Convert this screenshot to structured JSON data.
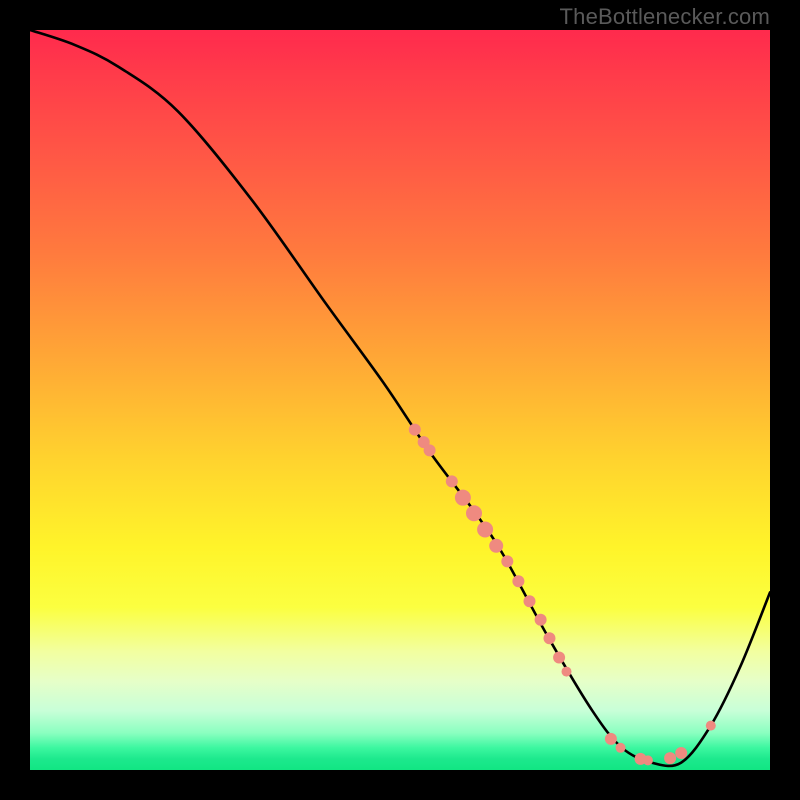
{
  "watermark": {
    "text": "TheBottlenecker.com"
  },
  "chart_data": {
    "type": "line",
    "title": "",
    "xlabel": "",
    "ylabel": "",
    "xlim": [
      0,
      100
    ],
    "ylim": [
      0,
      100
    ],
    "series": [
      {
        "name": "bottleneck-curve",
        "x": [
          0,
          6,
          12,
          20,
          30,
          40,
          48,
          54,
          60,
          64,
          70,
          76,
          80,
          84,
          88,
          92,
          96,
          100
        ],
        "values": [
          100,
          98,
          95,
          89,
          77,
          63,
          52,
          43,
          35,
          29,
          18,
          8,
          3,
          1,
          1,
          6,
          14,
          24
        ]
      }
    ],
    "markers": {
      "name": "highlight-points",
      "color": "#ef8a80",
      "points": [
        {
          "x": 52.0,
          "y": 46.0,
          "r": 6
        },
        {
          "x": 53.2,
          "y": 44.3,
          "r": 6
        },
        {
          "x": 54.0,
          "y": 43.2,
          "r": 6
        },
        {
          "x": 57.0,
          "y": 39.0,
          "r": 6
        },
        {
          "x": 58.5,
          "y": 36.8,
          "r": 8
        },
        {
          "x": 60.0,
          "y": 34.7,
          "r": 8
        },
        {
          "x": 61.5,
          "y": 32.5,
          "r": 8
        },
        {
          "x": 63.0,
          "y": 30.3,
          "r": 7
        },
        {
          "x": 64.5,
          "y": 28.2,
          "r": 6
        },
        {
          "x": 66.0,
          "y": 25.5,
          "r": 6
        },
        {
          "x": 67.5,
          "y": 22.8,
          "r": 6
        },
        {
          "x": 69.0,
          "y": 20.3,
          "r": 6
        },
        {
          "x": 70.2,
          "y": 17.8,
          "r": 6
        },
        {
          "x": 71.5,
          "y": 15.2,
          "r": 6
        },
        {
          "x": 72.5,
          "y": 13.3,
          "r": 5
        },
        {
          "x": 78.5,
          "y": 4.2,
          "r": 6
        },
        {
          "x": 79.8,
          "y": 3.0,
          "r": 5
        },
        {
          "x": 82.5,
          "y": 1.5,
          "r": 6
        },
        {
          "x": 83.5,
          "y": 1.3,
          "r": 5
        },
        {
          "x": 86.5,
          "y": 1.6,
          "r": 6
        },
        {
          "x": 88.0,
          "y": 2.3,
          "r": 6
        },
        {
          "x": 92.0,
          "y": 6.0,
          "r": 5
        }
      ]
    }
  }
}
